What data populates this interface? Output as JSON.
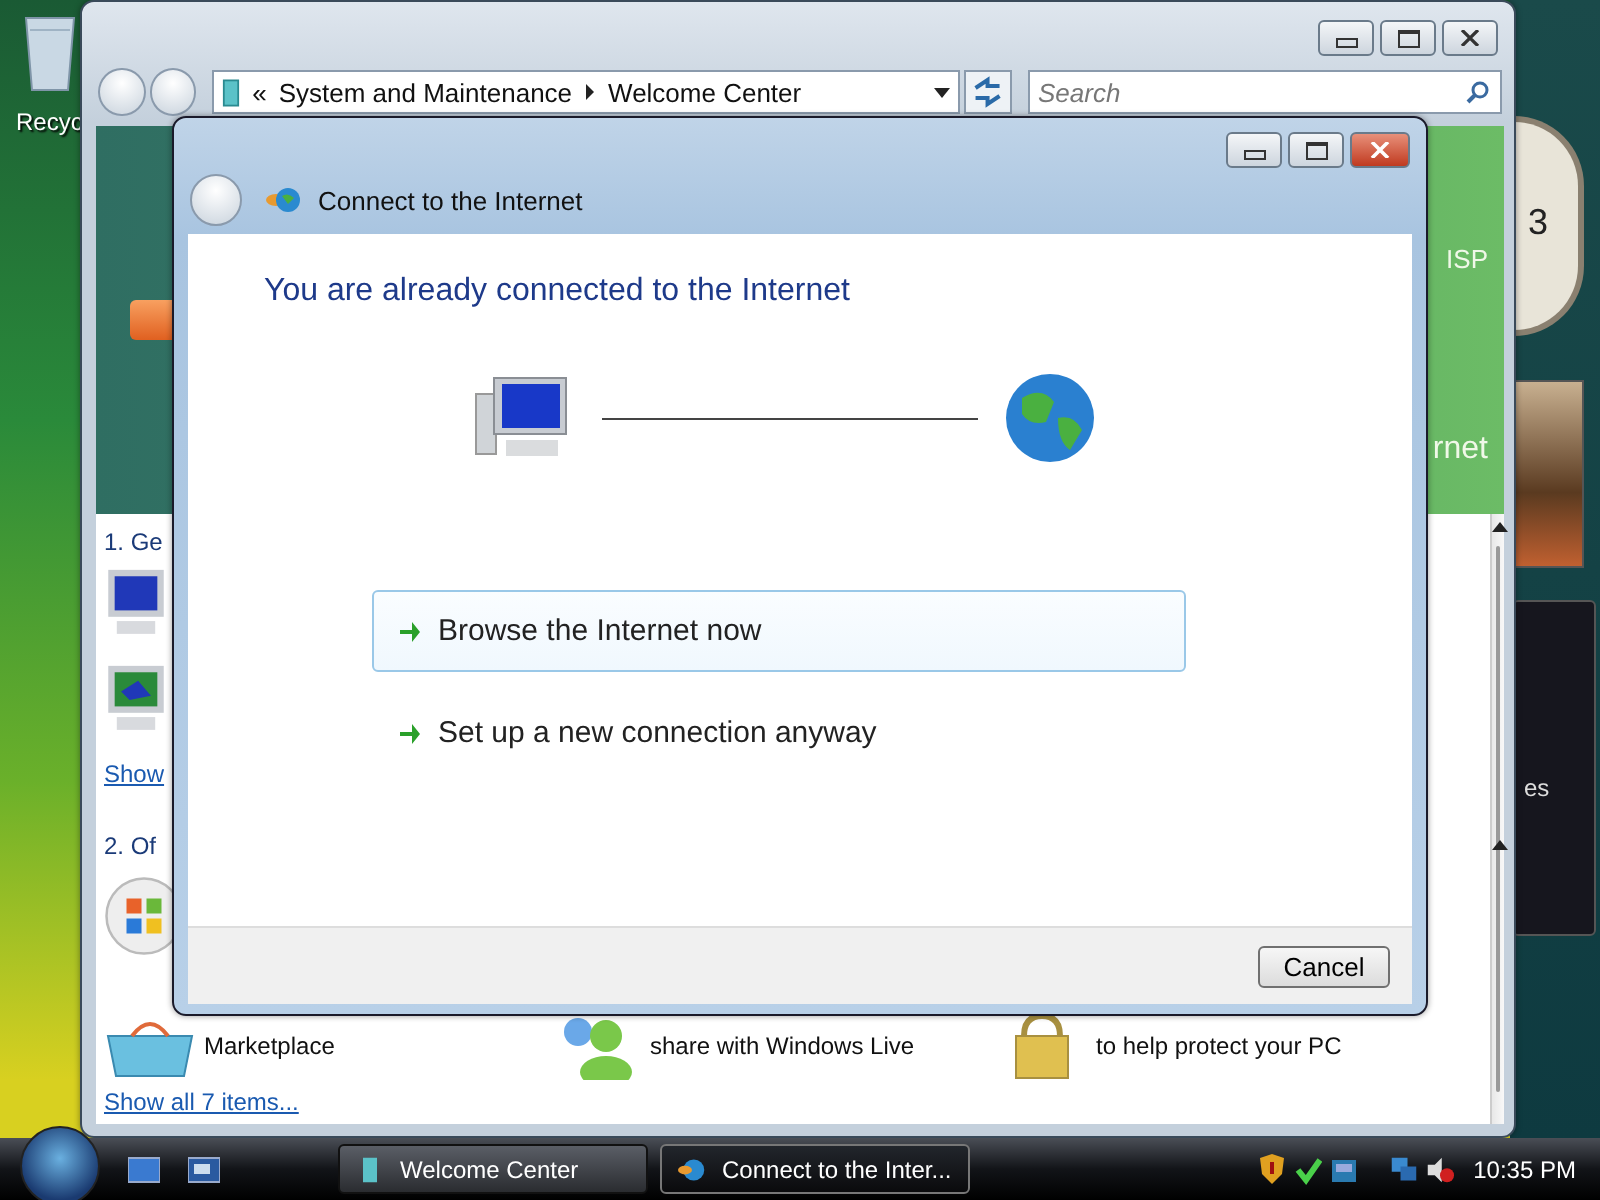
{
  "desktop": {
    "icons": [
      {
        "label": "Recyc"
      }
    ]
  },
  "explorer": {
    "breadcrumb_prefix": "«",
    "breadcrumb": [
      "System and Maintenance",
      "Welcome Center"
    ],
    "search": {
      "placeholder": "Search"
    },
    "banner_texts": [
      "ISP",
      "rnet"
    ],
    "sections": [
      {
        "heading": "1. Ge",
        "link": "Show"
      },
      {
        "heading": "2. Of"
      }
    ],
    "items": [
      {
        "label": "Marketplace"
      },
      {
        "label": "share with Windows Live"
      },
      {
        "label": "to help protect your PC"
      }
    ],
    "show_all": "Show all 7 items..."
  },
  "dialog": {
    "title": "Connect to the Internet",
    "heading": "You are already connected to the Internet",
    "options": [
      {
        "label": "Browse the Internet now",
        "selected": true
      },
      {
        "label": "Set up a new connection anyway",
        "selected": false
      }
    ],
    "buttons": [
      "Cancel"
    ]
  },
  "gadgets": {
    "clock_numeral": "3",
    "feed_text": "es"
  },
  "taskbar": {
    "buttons": [
      {
        "label": "Welcome Center",
        "selected": false
      },
      {
        "label": "Connect to the Inter...",
        "selected": true
      }
    ],
    "clock": "10:35 PM"
  }
}
